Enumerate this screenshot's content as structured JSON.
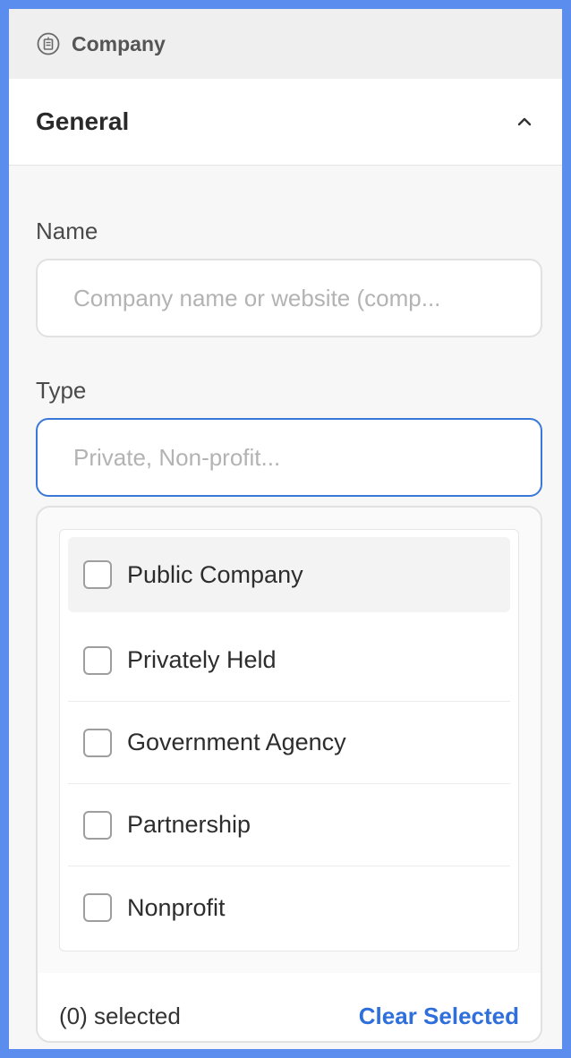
{
  "topbar": {
    "title": "Company",
    "icon": "company-icon"
  },
  "section": {
    "title": "General",
    "collapse_icon": "chevron-up-icon"
  },
  "name_field": {
    "label": "Name",
    "placeholder": "Company name or website (comp...",
    "value": ""
  },
  "type_field": {
    "label": "Type",
    "placeholder": "Private, Non-profit...",
    "value": ""
  },
  "type_options": [
    {
      "label": "Public Company",
      "checked": false
    },
    {
      "label": "Privately Held",
      "checked": false
    },
    {
      "label": "Government Agency",
      "checked": false
    },
    {
      "label": "Partnership",
      "checked": false
    },
    {
      "label": "Nonprofit",
      "checked": false
    }
  ],
  "footer": {
    "selected_count": "(0) selected",
    "clear_label": "Clear Selected"
  },
  "colors": {
    "accent": "#2f6fdb",
    "focus_border": "#3a78d8",
    "frame_border": "#5b8def"
  }
}
